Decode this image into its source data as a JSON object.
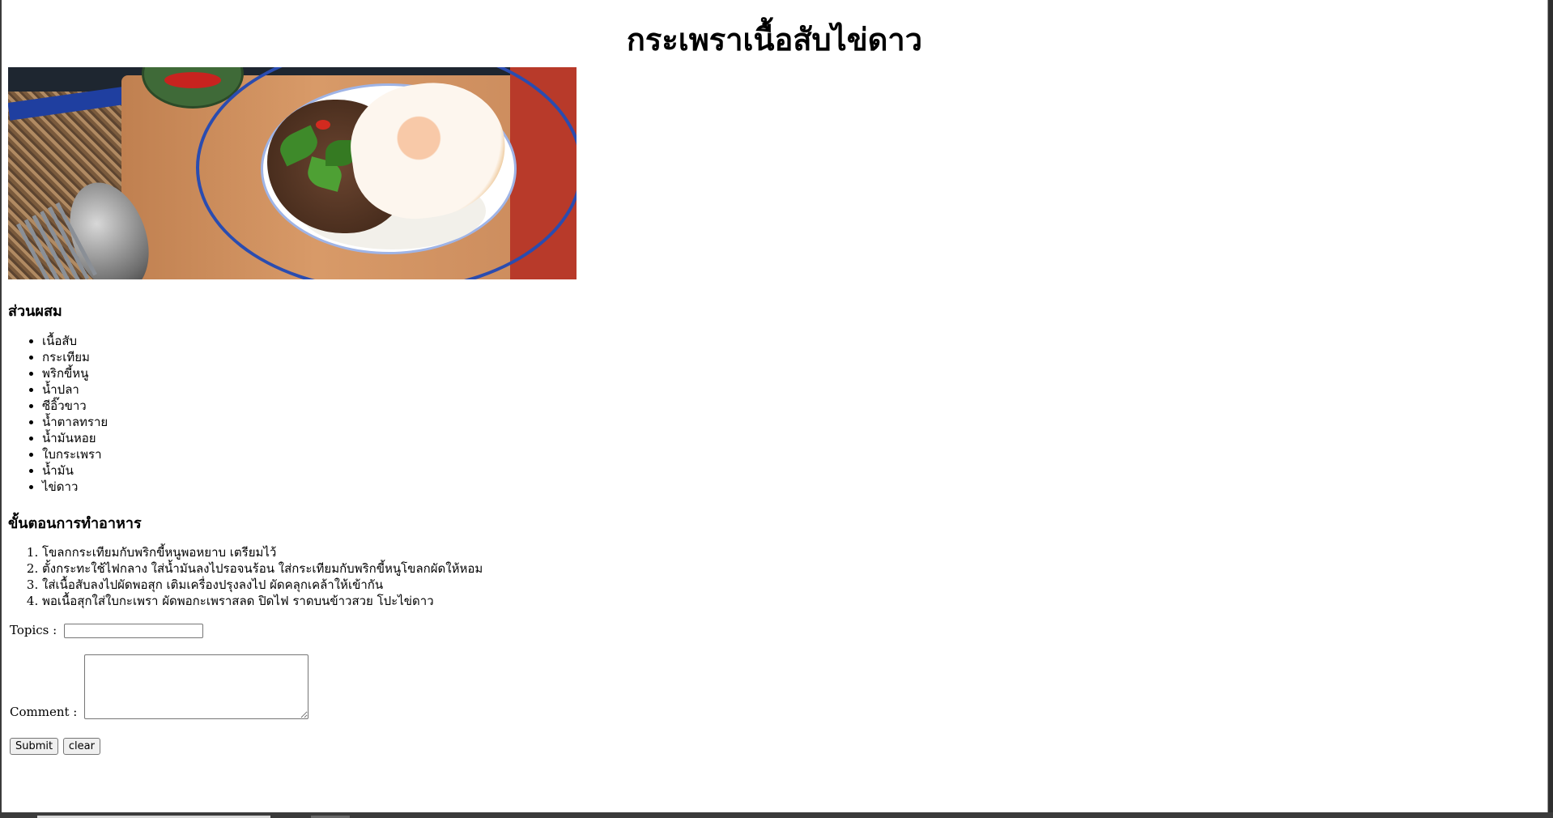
{
  "page": {
    "title": "กระเพราเนื้อสับไข่ดาว"
  },
  "ingredients": {
    "heading": "ส่วนผสม",
    "items": [
      "เนื้อสับ",
      "กระเทียม",
      "พริกขี้หนู",
      "น้ำปลา",
      "ซีอิ๊วขาว",
      "น้ำตาลทราย",
      "น้ำมันหอย",
      "ใบกระเพรา",
      "น้ำมัน",
      "ไข่ดาว"
    ]
  },
  "steps": {
    "heading": "ขั้นตอนการทำอาหาร",
    "items": [
      "โขลกกระเทียมกับพริกขี้หนูพอหยาบ เตรียมไว้",
      "ตั้งกระทะใช้ไฟกลาง ใส่น้ำมันลงไปรอจนร้อน ใส่กระเทียมกับพริกขี้หนูโขลกผัดให้หอม",
      "ใส่เนื้อสับลงไปผัดพอสุก เติมเครื่องปรุงลงไป ผัดคลุกเคล้าให้เข้ากัน",
      "พอเนื้อสุกใส่ใบกะเพรา ผัดพอกะเพราสลด ปิดไฟ ราดบนข้าวสวย โปะไข่ดาว"
    ]
  },
  "form": {
    "topics_label": "Topics :",
    "topics_value": "",
    "comment_label": "Comment :",
    "comment_value": "",
    "submit_label": "Submit",
    "clear_label": "clear"
  }
}
